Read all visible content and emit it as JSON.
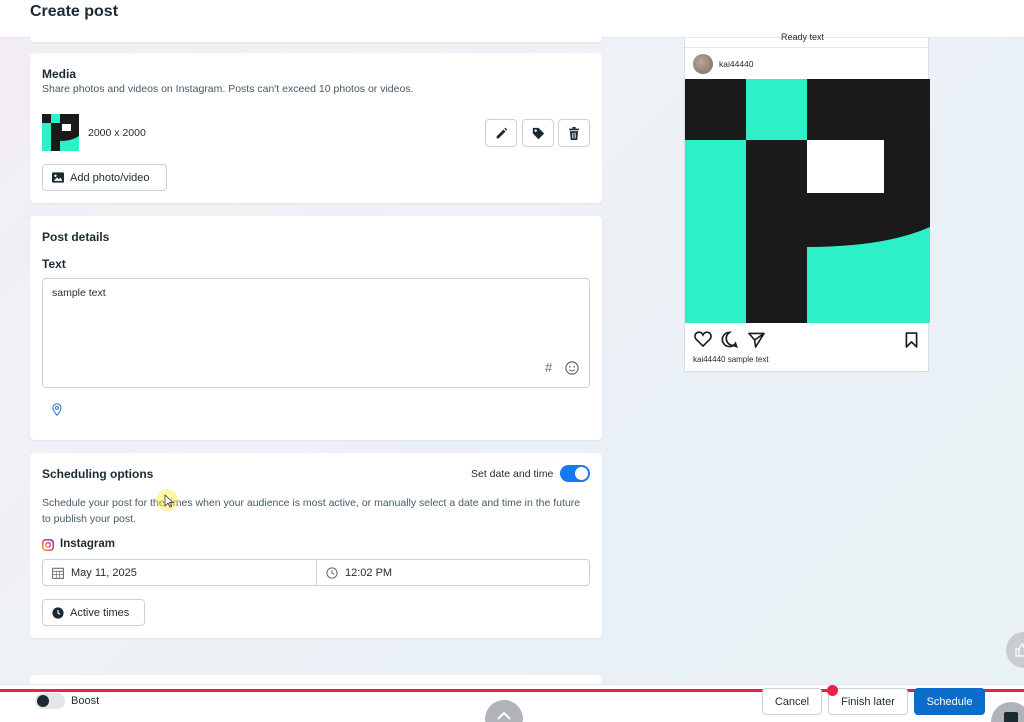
{
  "header": {
    "title": "Create post"
  },
  "media": {
    "title": "Media",
    "description": "Share photos and videos on Instagram. Posts can't exceed 10 photos or videos.",
    "dimensions": "2000 x 2000",
    "add_label": "Add photo/video",
    "icons": [
      "pencil-icon",
      "tag-icon",
      "trash-icon"
    ]
  },
  "post_details": {
    "title": "Post details",
    "text_label": "Text",
    "text_value": "sample text",
    "hashtag_symbol": "#"
  },
  "scheduling": {
    "title": "Scheduling options",
    "toggle_label": "Set date and time",
    "toggle_on": true,
    "description": "Schedule your post for the times when your audience is most active, or manually select a date and time in the future to publish your post.",
    "platform": "Instagram",
    "date": "May 11, 2025",
    "time": "12:02 PM",
    "active_times_label": "Active times"
  },
  "preview": {
    "top_text": "Ready text",
    "username": "kai44440",
    "caption": "kai44440 sample text"
  },
  "footer": {
    "boost_label": "Boost",
    "cancel_label": "Cancel",
    "finish_later_label": "Finish later",
    "schedule_label": "Schedule"
  },
  "colors": {
    "accent": "#1877f2",
    "schedule_button": "#0b6cc9",
    "brand_teal": "#2ef0c8",
    "brand_black": "#1a1a1a",
    "progress_red": "#ec1f4e"
  }
}
